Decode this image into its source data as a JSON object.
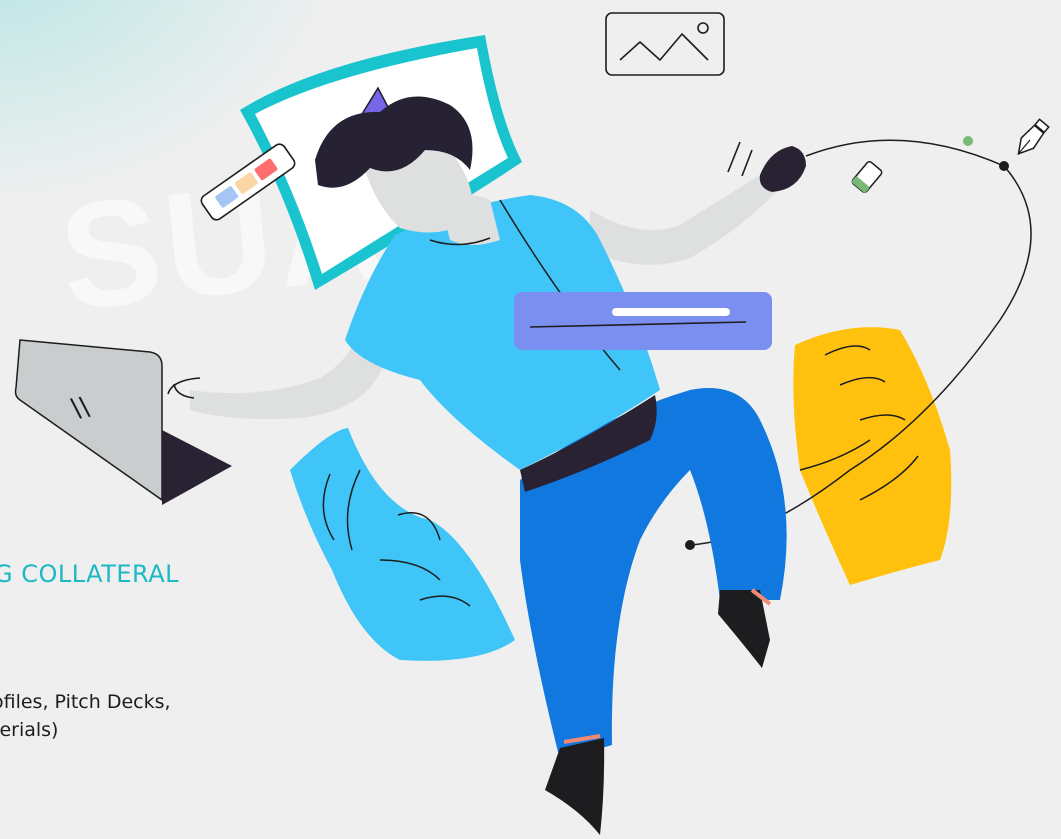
{
  "watermark_text": "SUAL",
  "section": {
    "heading": "G COLLATERAL",
    "description_line1": "ofiles, Pitch Decks,",
    "description_line2": "terials)"
  },
  "illustration": {
    "laptop_glyph": "\\\\",
    "colors": {
      "background": "#efefef",
      "accent_teal": "#1ab9c4",
      "shirt_blue": "#3fc5f7",
      "pants_blue": "#1178e0",
      "yellow": "#ffc10e",
      "purple_bar": "#7b8ff0",
      "hair": "#262233",
      "skin": "#dededf"
    }
  }
}
